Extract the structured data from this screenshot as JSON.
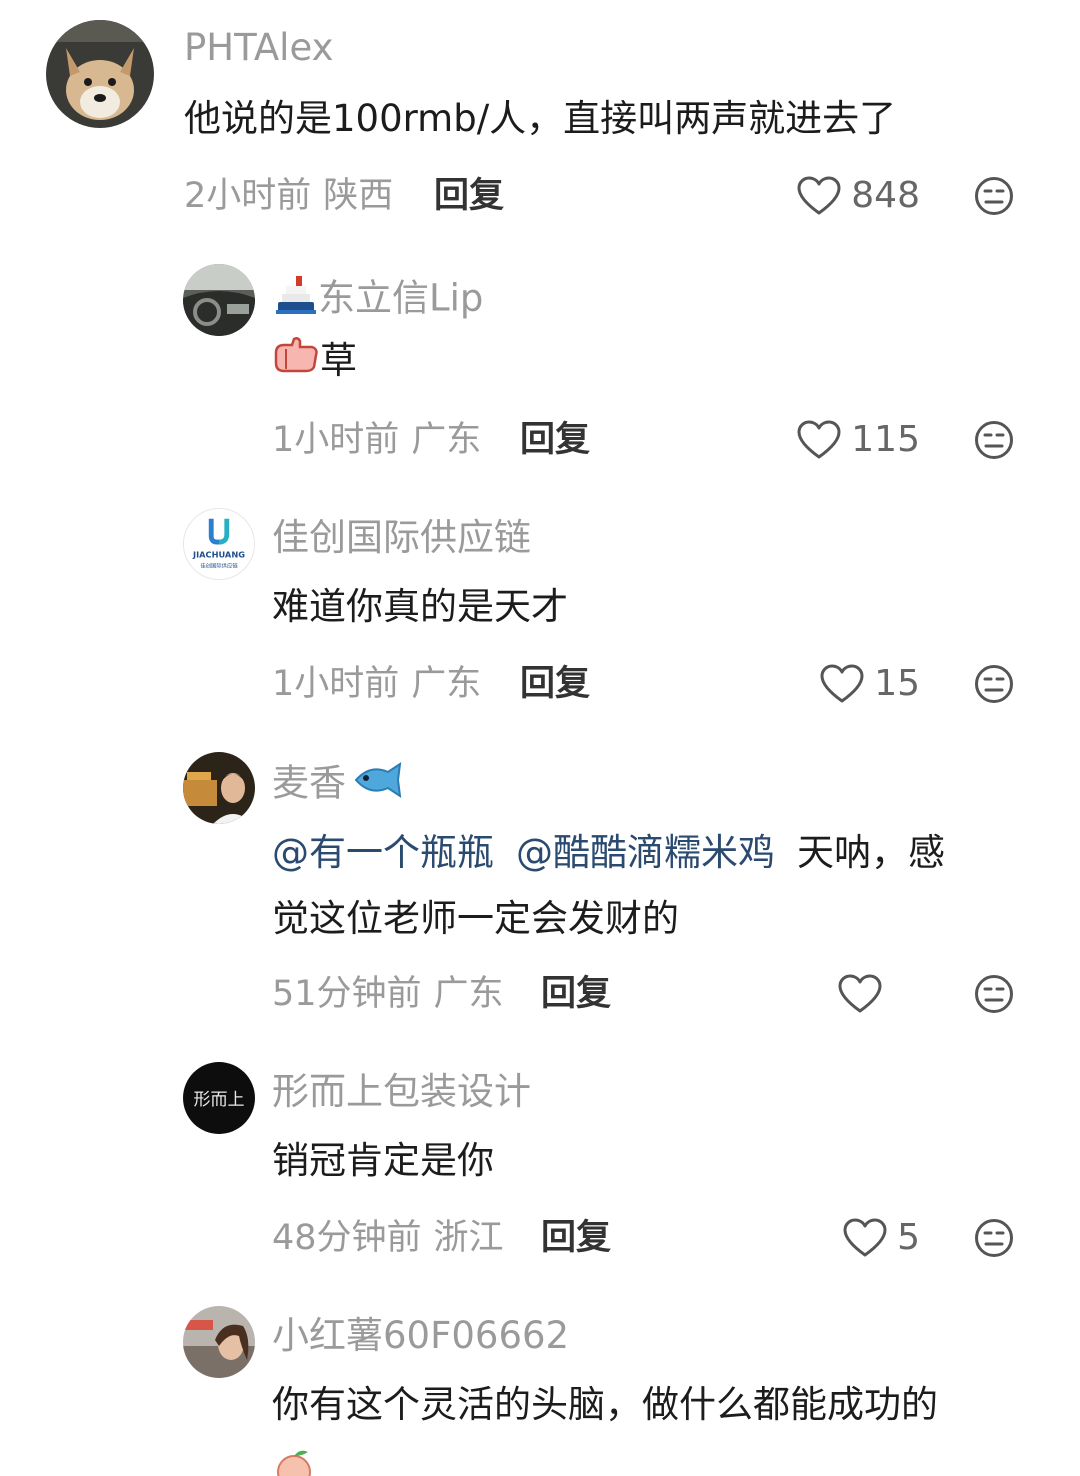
{
  "comments": [
    {
      "username": "PHTAlex",
      "text": "他说的是100rmb/人，直接叫两声就进去了",
      "time": "2小时前",
      "location": "陕西",
      "reply_label": "回复",
      "likes": "848"
    },
    {
      "username": "东立信Lip",
      "username_icon": "ship-icon",
      "text": "草",
      "text_icon": "thumbs-up-icon",
      "time": "1小时前",
      "location": "广东",
      "reply_label": "回复",
      "likes": "115"
    },
    {
      "username": "佳创国际供应链",
      "avatar_logo_text": "JIACHUANG",
      "avatar_logo_subtext": "佳创国际供应链",
      "text": "难道你真的是天才",
      "time": "1小时前",
      "location": "广东",
      "reply_label": "回复",
      "likes": "15"
    },
    {
      "username": "麦香",
      "username_icon": "fish-icon",
      "mention1": "@有一个瓶瓶",
      "mention2": "@酷酷滴糯米鸡",
      "text_line1": "天呐，感",
      "text_line2": "觉这位老师一定会发财的",
      "time": "51分钟前",
      "location": "广东",
      "reply_label": "回复",
      "likes": ""
    },
    {
      "username": "形而上包装设计",
      "avatar_logo_text": "形而上",
      "text": "销冠肯定是你",
      "time": "48分钟前",
      "location": "浙江",
      "reply_label": "回复",
      "likes": "5"
    },
    {
      "username": "小红薯60F06662",
      "text": "你有这个灵活的头脑，做什么都能成功的",
      "trailing_icon": "peach-emoji-icon"
    }
  ],
  "colors": {
    "username": "#9a9a9a",
    "text": "#1c1c1c",
    "mention": "#2b4a70",
    "meta": "#9a9a9a",
    "reply": "#333333"
  }
}
